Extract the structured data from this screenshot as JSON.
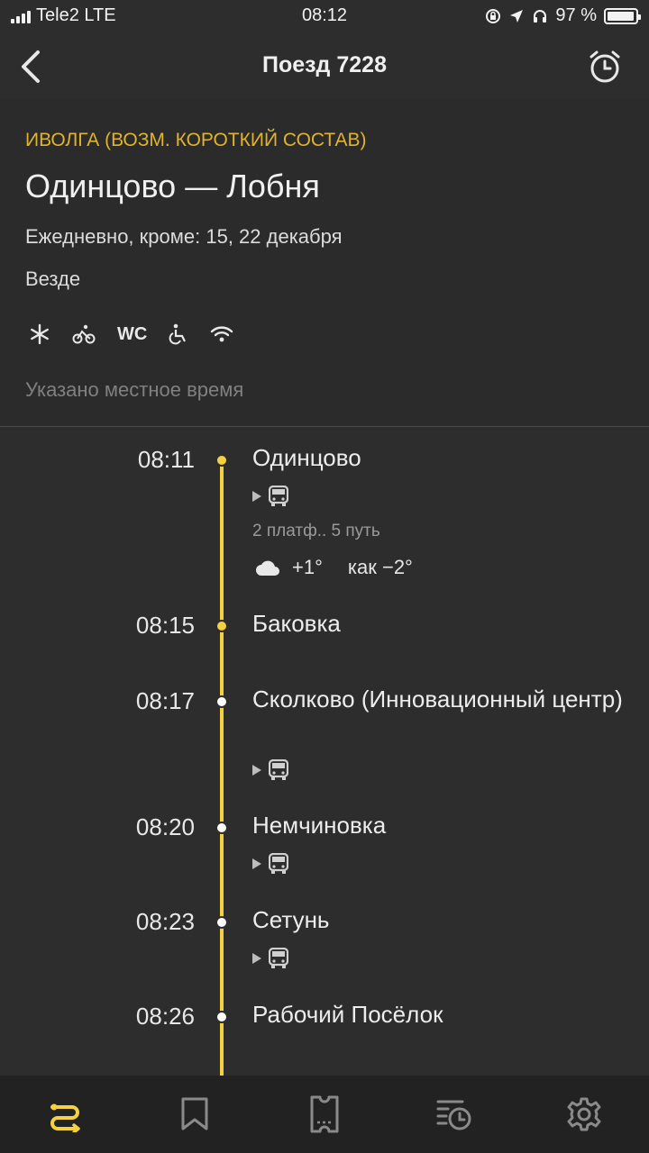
{
  "status_bar": {
    "carrier": "Tele2",
    "network": "LTE",
    "time": "08:12",
    "battery": "97 %",
    "battery_level": 0.97
  },
  "nav": {
    "title": "Поезд 7228"
  },
  "train": {
    "type": "ИВОЛГА (ВОЗМ. КОРОТКИЙ СОСТАВ)",
    "route": "Одинцово — Лобня",
    "days": "Ежедневно, кроме: 15, 22 декабря",
    "stops_mode": "Везде",
    "amenities": [
      "snowflake-icon",
      "bicycle-icon",
      "wc-icon",
      "wheelchair-icon",
      "wifi-icon"
    ],
    "wc_label": "WC",
    "local_time_note": "Указано местное время"
  },
  "stops": [
    {
      "time": "08:11",
      "name": "Одинцово",
      "passed": true,
      "transfer": true,
      "platform": "2 платф.. 5 путь",
      "weather": {
        "temp": "+1°",
        "feels": "как −2°"
      }
    },
    {
      "time": "08:15",
      "name": "Баковка",
      "passed": true,
      "transfer": false
    },
    {
      "time": "08:17",
      "name": "Сколково (Инновационный центр)",
      "passed": false,
      "transfer": true
    },
    {
      "time": "08:20",
      "name": "Немчиновка",
      "passed": false,
      "transfer": true
    },
    {
      "time": "08:23",
      "name": "Сетунь",
      "passed": false,
      "transfer": true
    },
    {
      "time": "08:26",
      "name": "Рабочий Посёлок",
      "passed": false,
      "transfer": false
    }
  ],
  "colors": {
    "accent": "#f5d142",
    "train_type": "#e0b32f",
    "background": "#2d2d2d",
    "tab_bar": "#222222"
  },
  "tabs": [
    {
      "icon": "route-icon",
      "active": true
    },
    {
      "icon": "bookmark-icon",
      "active": false
    },
    {
      "icon": "ticket-icon",
      "active": false
    },
    {
      "icon": "history-icon",
      "active": false
    },
    {
      "icon": "gear-icon",
      "active": false
    }
  ]
}
